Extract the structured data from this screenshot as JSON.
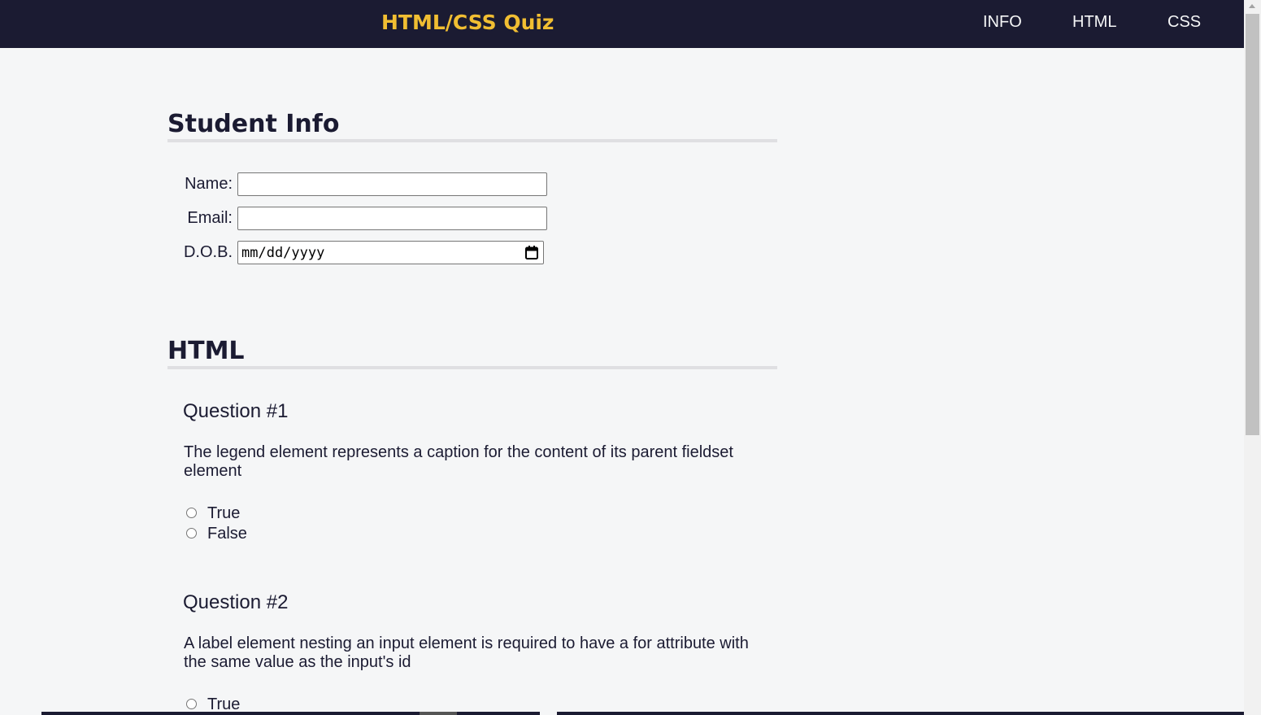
{
  "header": {
    "title": "HTML/CSS Quiz",
    "nav": [
      {
        "label": "INFO"
      },
      {
        "label": "HTML"
      },
      {
        "label": "CSS"
      }
    ]
  },
  "student_info": {
    "heading": "Student Info",
    "fields": {
      "name": {
        "label": "Name:",
        "value": ""
      },
      "email": {
        "label": "Email:",
        "value": ""
      },
      "dob": {
        "label": "D.O.B.",
        "placeholder": "mm/dd/yyyy"
      }
    }
  },
  "html_section": {
    "heading": "HTML",
    "questions": [
      {
        "title": "Question #1",
        "text": "The legend element represents a caption for the content of its parent fieldset element",
        "options": [
          "True",
          "False"
        ]
      },
      {
        "title": "Question #2",
        "text": "A label element nesting an input element is required to have a for attribute with the same value as the input's id",
        "options": [
          "True"
        ]
      }
    ]
  },
  "colors": {
    "header_bg": "#1b1b32",
    "title_accent": "#f1be32",
    "page_bg": "#f5f6f7",
    "text": "#1b1b32",
    "divider": "#dfdfe2"
  },
  "icons": {
    "date_picker": "calendar-icon"
  }
}
